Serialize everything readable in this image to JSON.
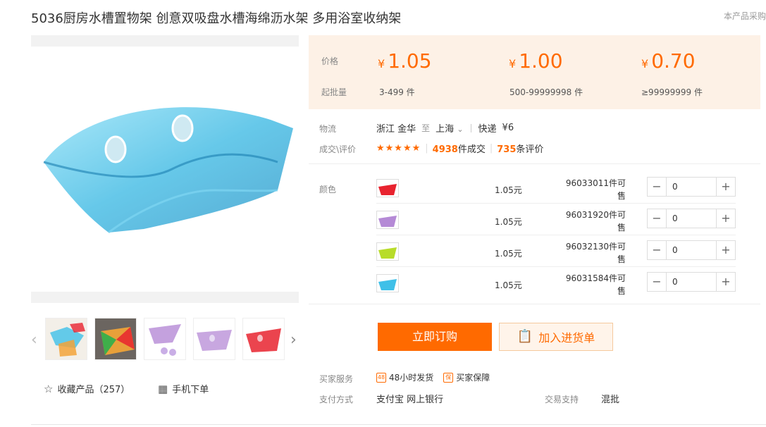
{
  "product": {
    "title": "5036厨房水槽置物架 创意双吸盘水槽海绵沥水架 多用浴室收纳架",
    "top_right_note": "本产品采购"
  },
  "price_box": {
    "price_label": "价格",
    "moq_label": "起批量",
    "currency": "¥",
    "tiers": [
      {
        "price": "1.05",
        "qty": "3-499 件"
      },
      {
        "price": "1.00",
        "qty": "500-99999998 件"
      },
      {
        "price": "0.70",
        "qty": "≥99999999 件"
      }
    ]
  },
  "logistics": {
    "label": "物流",
    "from": "浙江 金华",
    "to_word": "至",
    "to": "上海",
    "express": "快递",
    "fee": "¥6"
  },
  "deals": {
    "label": "成交\\评价",
    "stars": "★★★★★",
    "sold_count": "4938",
    "sold_suffix": "件成交",
    "review_count": "735",
    "review_suffix": "条评价",
    "rating": 4.5
  },
  "variants": {
    "label": "颜色",
    "items": [
      {
        "color": "#e8232f",
        "price": "1.05元",
        "stock_line1": "96033011件可",
        "stock_line2": "售",
        "qty": "0"
      },
      {
        "color": "#b58ad6",
        "price": "1.05元",
        "stock_line1": "96031920件可",
        "stock_line2": "售",
        "qty": "0"
      },
      {
        "color": "#b8dc2a",
        "price": "1.05元",
        "stock_line1": "96032130件可",
        "stock_line2": "售",
        "qty": "0"
      },
      {
        "color": "#3fc0e8",
        "price": "1.05元",
        "stock_line1": "96031584件可",
        "stock_line2": "售",
        "qty": "0"
      }
    ]
  },
  "buttons": {
    "buy": "立即订购",
    "add_cart": "加入进货单"
  },
  "services": {
    "label": "买家服务",
    "items": [
      "48小时发货",
      "买家保障"
    ],
    "badges": [
      "48",
      "保"
    ]
  },
  "payment": {
    "label": "支付方式",
    "methods": "支付宝  网上银行",
    "trade_label": "交易支持",
    "trade_value": "混批"
  },
  "gallery": {
    "favorite": "收藏产品（257）",
    "mobile_order": "手机下单",
    "thumb_colors": [
      "#3fc0e8",
      "#e8a03a",
      "#b58ad6",
      "#b58ad6",
      "#e8232f"
    ],
    "main_color": "#3fb8e0"
  }
}
